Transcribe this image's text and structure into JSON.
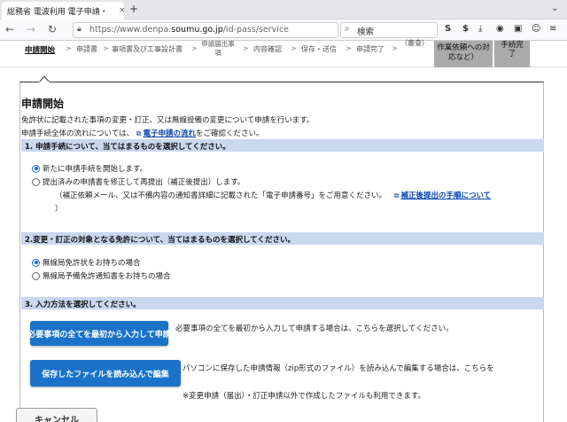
{
  "browser": {
    "tab_title": "総務省 電波利用 電子申請・",
    "tab_close": "×",
    "new_tab": "+",
    "url_prefix": "https://www.denpa.",
    "url_domain": "soumu.go.jp",
    "url_rest": "/id-pass/service",
    "search_placeholder": "検索"
  },
  "steps": {
    "s1": "申請開始",
    "s2": "申請書",
    "s3": "事項書及び工事設計書",
    "s4_l1": "申請届出事",
    "s4_l2": "項",
    "s5": "内容確認",
    "s6": "保存・送信",
    "s7": "申請完了",
    "s8": "（審査）",
    "s9": "作業依頼への対応など）",
    "s10_l1": "手続完",
    "s10_l2": "了",
    "arrow": ">"
  },
  "main": {
    "title": "申請開始",
    "intro": "免許状に記載された事項の変更・訂正、又は無線設備の変更について申請を行います。",
    "flow_prefix": "申請手続全体の流れについては、",
    "flow_link": "電子申請の流れ",
    "flow_suffix": "をご確認ください。"
  },
  "section1": {
    "header": "1. 申請手続について、当てはまるものを選択してください。",
    "opt1": "新たに申請手続を開始します。",
    "opt2": "提出済みの申請書を修正して再提出（補正後提出）します。",
    "note": "（補正依頼メール、又は不備内容の通知書詳細に記載された「電子申請番号」をご用意ください。",
    "note_link": "補正後提出の手順について",
    "note_close": "）"
  },
  "section2": {
    "header": "2.変更・訂正の対象となる免許について、当てはまるものを選択してください。",
    "opt1": "無線局免許状をお持ちの場合",
    "opt2": "無線局予備免許通知書をお持ちの場合"
  },
  "section3": {
    "header": "3. 入力方法を選択してください。",
    "btn1": "必要事項の全てを最初から入力して申請",
    "btn1_desc": "必要事項の全てを最初から入力して申請する場合は、こちらを選択してください。",
    "btn2": "保存したファイルを読み込んで編集",
    "btn2_desc": "パソコンに保存した申請情報（zip形式のファイル）を読み込んで編集する場合は、こちらを",
    "btn2_note": "※変更申請（届出）・訂正申請以外で作成したファイルも利用できます。"
  },
  "footer": {
    "cancel": "キャンセル"
  },
  "colors": {
    "section_bg": "#c9d7ef",
    "button_blue": "#1a73c8",
    "link": "#0645ad"
  }
}
